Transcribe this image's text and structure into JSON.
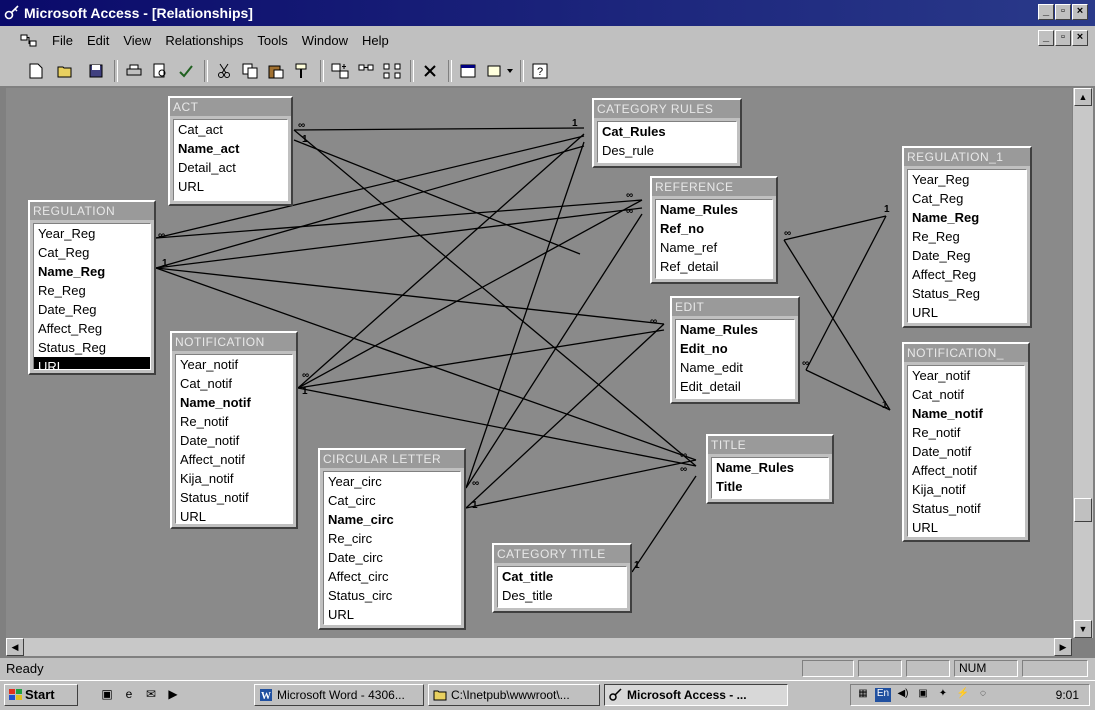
{
  "window": {
    "title": "Microsoft Access - [Relationships]",
    "min_glyph": "_",
    "max_glyph": "▫",
    "close_glyph": "×"
  },
  "menu": [
    "File",
    "Edit",
    "View",
    "Relationships",
    "Tools",
    "Window",
    "Help"
  ],
  "toolbar": {
    "icons": [
      "new-icon",
      "open-icon",
      "save-icon",
      "print-icon",
      "print-preview-icon",
      "spelling-icon",
      "cut-icon",
      "copy-icon",
      "paste-icon",
      "format-painter-icon",
      "show-table-icon",
      "show-direct-icon",
      "show-all-icon",
      "delete-icon",
      "new-object-icon",
      "office-links-icon",
      "help-icon"
    ]
  },
  "tables": [
    {
      "id": "act",
      "title": "ACT",
      "fields": [
        {
          "name": "Cat_act"
        },
        {
          "name": "Name_act",
          "key": true
        },
        {
          "name": "Detail_act"
        },
        {
          "name": "URL"
        }
      ]
    },
    {
      "id": "category_rules",
      "title": "CATEGORY RULES",
      "fields": [
        {
          "name": "Cat_Rules",
          "key": true
        },
        {
          "name": "Des_rule"
        }
      ]
    },
    {
      "id": "regulation",
      "title": "REGULATION",
      "fields": [
        {
          "name": "Year_Reg"
        },
        {
          "name": "Cat_Reg"
        },
        {
          "name": "Name_Reg",
          "key": true
        },
        {
          "name": "Re_Reg"
        },
        {
          "name": "Date_Reg"
        },
        {
          "name": "Affect_Reg"
        },
        {
          "name": "Status_Reg"
        },
        {
          "name": "URL",
          "selected": true
        }
      ]
    },
    {
      "id": "reference",
      "title": "REFERENCE",
      "fields": [
        {
          "name": "Name_Rules",
          "key": true
        },
        {
          "name": "Ref_no",
          "key": true
        },
        {
          "name": "Name_ref"
        },
        {
          "name": "Ref_detail"
        }
      ]
    },
    {
      "id": "regulation_1",
      "title": "REGULATION_1",
      "fields": [
        {
          "name": "Year_Reg"
        },
        {
          "name": "Cat_Reg"
        },
        {
          "name": "Name_Reg",
          "key": true
        },
        {
          "name": "Re_Reg"
        },
        {
          "name": "Date_Reg"
        },
        {
          "name": "Affect_Reg"
        },
        {
          "name": "Status_Reg"
        },
        {
          "name": "URL"
        }
      ]
    },
    {
      "id": "notification",
      "title": "NOTIFICATION",
      "fields": [
        {
          "name": "Year_notif"
        },
        {
          "name": "Cat_notif"
        },
        {
          "name": "Name_notif",
          "key": true
        },
        {
          "name": "Re_notif"
        },
        {
          "name": "Date_notif"
        },
        {
          "name": "Affect_notif"
        },
        {
          "name": "Kija_notif"
        },
        {
          "name": "Status_notif"
        },
        {
          "name": "URL"
        }
      ]
    },
    {
      "id": "edit",
      "title": "EDIT",
      "fields": [
        {
          "name": "Name_Rules",
          "key": true
        },
        {
          "name": "Edit_no",
          "key": true
        },
        {
          "name": "Name_edit"
        },
        {
          "name": "Edit_detail"
        }
      ]
    },
    {
      "id": "notification_1",
      "title": "NOTIFICATION_",
      "fields": [
        {
          "name": "Year_notif"
        },
        {
          "name": "Cat_notif"
        },
        {
          "name": "Name_notif",
          "key": true
        },
        {
          "name": "Re_notif"
        },
        {
          "name": "Date_notif"
        },
        {
          "name": "Affect_notif"
        },
        {
          "name": "Kija_notif"
        },
        {
          "name": "Status_notif"
        },
        {
          "name": "URL"
        }
      ]
    },
    {
      "id": "circular_letter",
      "title": "CIRCULAR LETTER",
      "fields": [
        {
          "name": "Year_circ"
        },
        {
          "name": "Cat_circ"
        },
        {
          "name": "Name_circ",
          "key": true
        },
        {
          "name": "Re_circ"
        },
        {
          "name": "Date_circ"
        },
        {
          "name": "Affect_circ"
        },
        {
          "name": "Status_circ"
        },
        {
          "name": "URL"
        }
      ]
    },
    {
      "id": "title",
      "title": "TITLE",
      "fields": [
        {
          "name": "Name_Rules",
          "key": true
        },
        {
          "name": "Title",
          "key": true
        }
      ]
    },
    {
      "id": "category_title",
      "title": "CATEGORY TITLE",
      "fields": [
        {
          "name": "Cat_title",
          "key": true
        },
        {
          "name": "Des_title"
        }
      ]
    }
  ],
  "relations": {
    "one_label": "1",
    "many_label": "∞"
  },
  "status": {
    "ready": "Ready",
    "num": "NUM"
  },
  "taskbar": {
    "start": "Start",
    "tasks": [
      {
        "label": "Microsoft Word - 4306...",
        "icon": "word-icon"
      },
      {
        "label": "C:\\Inetpub\\wwwroot\\...",
        "icon": "folder-icon"
      },
      {
        "label": "Microsoft Access - ...",
        "icon": "access-icon",
        "active": true
      }
    ],
    "clock": "9:01"
  }
}
